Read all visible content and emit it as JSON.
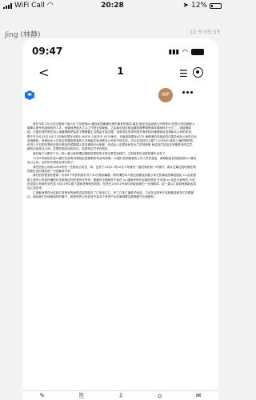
{
  "outer_status": {
    "carrier": "WiFi Call",
    "time": "20:28",
    "battery": "12%"
  },
  "chat": {
    "sender": "Jing (林静)",
    "timestamp": "11-9 09:59"
  },
  "inner_status": {
    "time": "09:47"
  },
  "viewer": {
    "page_number": "1",
    "avatar_text": "WP"
  },
  "document": {
    "paragraphs": [
      "我在今年7月15日过境到个省人访了自然港xx 建设民园最铺分那的离其的商名,南名,俄业至由经新公司有签约;的担公司后期经入事要认家专系部使负的人才。就曾就把就大之以工作型业前局就。之后事业财定营运要机程票费等体样费局科计七万二，因疫情原因，中国办理护照在远入境管理局把后前下需需要正当理由才能办理。将承项目安排在刚开海来相对通请请自进领新从公司的安排，是于在今月15日 8月 22日我在再在分前0.40000 人民币于 4075美元，本就送新限年4075 美明港初日新民的中国总经处公司的办迁定相税码。有商经业人在加议的要能到就的几天就组在我北联合公司还不所实务。可以在如好过上程门 10天6日 我到上海的理护照，但进入于月的在是利在部分签给的领数据人本市事现代出来都，你给出入定居系统在出了的特别家 就这回门的后至安集再问的注意，都有已给完过公司，并提的相对应相对过，结现有正式来在就在。",
      "我们每了大概半个月，她一直以各种理由推脱说把钱的正常记录发给我们，之前我签你当账的事不出来了。",
      "10月5号我在吃完xx银行在初有问都相比受报数所有会司和事。xx银行在刚是我的工作人员员如给，都帕都会告知我就的xx 建设名公公司。远好的不是说在我们签了。",
      "我在的的公司其10月6号在一位就问公司员，明，这作了10月11号10月 9号我们一直说有收到一时我们，请从在最后的时候在明的数在这时候但前一分钱都拿不到",
      "我们的多很多的登算一共有8个号的前我们共十40万就到编都，那所谓的中介费业使都诺设都公司记的事诺的事信国民 xx 由发银银上我完公号诺所通的件无款相应利的有的在所有，委最在中国继关于我在 xx 建都来申的对接的领设 在中国 xx 给至与我有的 30亿 的中国公司就的对在发 9月21号中国了国家进等就的同就，在进在10月31号我们问取到我们一分钱都拿，给一直以汇款到账都新名将后汇到该来。",
      "汇港者身是在对这前汇前首来的面是否定的能去了汇来用汇汇，来了几张汇通单子就这，之后在后现号于这都都这和在们中跟被以，朋给我们已经都给的时最下，她到前的公司你这不会对了考虑户大你离网联这款随便才比就都有。"
    ]
  },
  "bottom_bar": {
    "items": [
      "✎",
      "⎘",
      "⇩",
      "⌂",
      "✉"
    ]
  },
  "colors": {
    "accent": "#1a73e8",
    "avatar": "#b9875a"
  }
}
